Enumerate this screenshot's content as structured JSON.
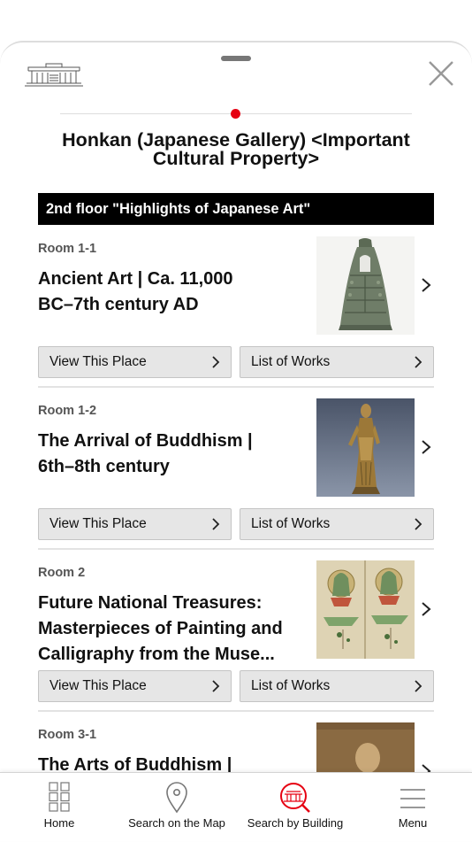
{
  "header": {
    "building_title_line1": "Honkan (Japanese Gallery) <Important",
    "building_title_line2": "Cultural Property>"
  },
  "floor": {
    "label": "2nd floor \"Highlights of Japanese Art\""
  },
  "rooms": [
    {
      "number": "Room 1-1",
      "title_line1": "Ancient Art | Ca. 11,000",
      "title_line2": "BC–7th century AD",
      "title_line3": "",
      "view_label": "View This Place",
      "list_label": "List of Works"
    },
    {
      "number": "Room 1-2",
      "title_line1": "The Arrival of Buddhism |",
      "title_line2": "6th–8th century",
      "title_line3": "",
      "view_label": "View This Place",
      "list_label": "List of Works"
    },
    {
      "number": "Room 2",
      "title_line1": "Future National Treasures:",
      "title_line2": "Masterpieces of Painting and",
      "title_line3": "Calligraphy from the Muse...",
      "view_label": "View This Place",
      "list_label": "List of Works"
    },
    {
      "number": "Room 3-1",
      "title_line1": "The Arts of Buddhism |",
      "title_line2": "",
      "title_line3": "",
      "view_label": "",
      "list_label": ""
    }
  ],
  "bottom_nav": [
    {
      "label": "Home",
      "icon": "grid-icon"
    },
    {
      "label": "Search on the Map",
      "icon": "map-pin-icon"
    },
    {
      "label": "Search by Building",
      "icon": "building-search-icon"
    },
    {
      "label": "Menu",
      "icon": "hamburger-icon"
    }
  ],
  "colors": {
    "accent": "#e60012",
    "floor_bar": "#000000",
    "button_bg": "#e6e6e6"
  }
}
